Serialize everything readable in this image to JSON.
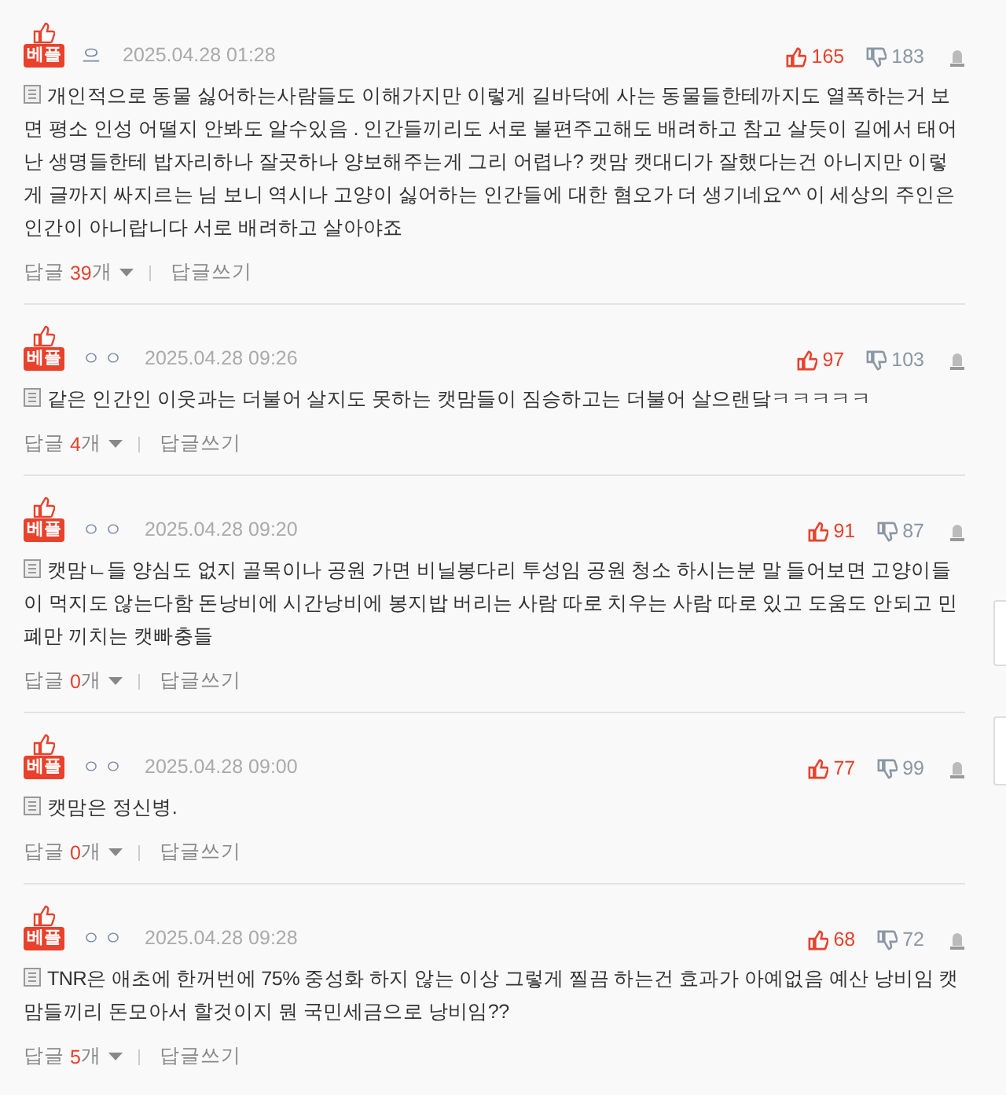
{
  "comments": [
    {
      "badge": "베플",
      "author": "으",
      "date": "2025.04.28 01:28",
      "likes": "165",
      "dislikes": "183",
      "text": "개인적으로 동물 싫어하는사람들도 이해가지만 이렇게 길바닥에 사는 동물들한테까지도 열폭하는거 보면 평소 인성 어떨지 안봐도 알수있음 . 인간들끼리도 서로 불편주고해도 배려하고 참고 살듯이 길에서 태어난 생명들한테 밥자리하나 잘곳하나 양보해주는게 그리 어렵나? 캣맘 캣대디가 잘했다는건 아니지만 이렇게 글까지 싸지르는 님 보니 역시나 고양이 싫어하는 인간들에 대한 혐오가 더 생기네요^^ 이 세상의 주인은 인간이 아니랍니다 서로 배려하고 살아야죠",
      "reply_label": "답글",
      "reply_count": "39",
      "reply_unit": "개",
      "write_reply": "답글쓰기"
    },
    {
      "badge": "베플",
      "author": "ㅇㅇ",
      "date": "2025.04.28 09:26",
      "likes": "97",
      "dislikes": "103",
      "text": "같은 인간인 이웃과는 더불어 살지도 못하는 캣맘들이 짐승하고는 더불어 살으랜닼ㅋㅋㅋㅋㅋ",
      "reply_label": "답글",
      "reply_count": "4",
      "reply_unit": "개",
      "write_reply": "답글쓰기"
    },
    {
      "badge": "베플",
      "author": "ㅇㅇ",
      "date": "2025.04.28 09:20",
      "likes": "91",
      "dislikes": "87",
      "text": "캣맘ㄴ들 양심도 없지 골목이나 공원 가면 비닐봉다리 투성임 공원 청소 하시는분 말 들어보면 고양이들이 먹지도 않는다함 돈낭비에 시간낭비에 봉지밥 버리는 사람 따로 치우는 사람 따로 있고 도움도 안되고 민폐만 끼치는 캣빠충들",
      "reply_label": "답글",
      "reply_count": "0",
      "reply_unit": "개",
      "write_reply": "답글쓰기"
    },
    {
      "badge": "베플",
      "author": "ㅇㅇ",
      "date": "2025.04.28 09:00",
      "likes": "77",
      "dislikes": "99",
      "text": "캣맘은 정신병.",
      "reply_label": "답글",
      "reply_count": "0",
      "reply_unit": "개",
      "write_reply": "답글쓰기"
    },
    {
      "badge": "베플",
      "author": "ㅇㅇ",
      "date": "2025.04.28 09:28",
      "likes": "68",
      "dislikes": "72",
      "text": "TNR은 애초에 한꺼번에 75% 중성화 하지 않는 이상 그렇게 찔끔 하는건 효과가 아예없음 예산 낭비임 캣맘들끼리 돈모아서 할것이지 뭔 국민세금으로 낭비임??",
      "reply_label": "답글",
      "reply_count": "5",
      "reply_unit": "개",
      "write_reply": "답글쓰기"
    }
  ]
}
